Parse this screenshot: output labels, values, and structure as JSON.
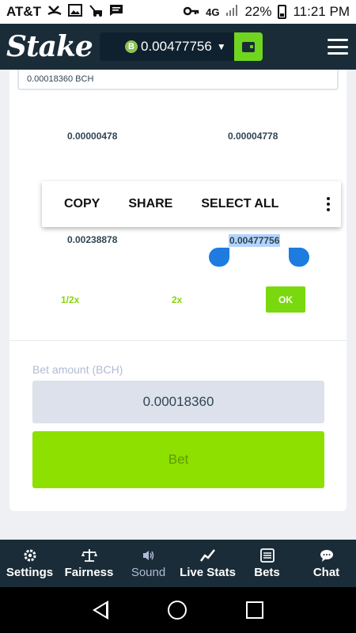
{
  "status_bar": {
    "carrier": "AT&T",
    "network": "4G",
    "battery": "22%",
    "time": "11:21 PM"
  },
  "header": {
    "logo": "Stake",
    "balance": "0.00477756",
    "currency_icon": "B"
  },
  "card": {
    "top_input_value": "0.00018360 BCH",
    "amounts": [
      "0.00000478",
      "0.00004778",
      "0.00238878",
      "0.00477756"
    ],
    "quick_buttons": {
      "half": "1/2x",
      "double": "2x",
      "ok": "OK"
    },
    "bet_amount_label": "Bet amount (BCH)",
    "bet_amount_value": "0.00018360",
    "bet_button": "Bet"
  },
  "context_menu": {
    "copy": "COPY",
    "share": "SHARE",
    "select_all": "SELECT ALL"
  },
  "bottom_tabs": [
    {
      "label": "Settings",
      "icon": "gear-icon"
    },
    {
      "label": "Fairness",
      "icon": "scale-icon"
    },
    {
      "label": "Sound",
      "icon": "speaker-icon"
    },
    {
      "label": "Live Stats",
      "icon": "chart-line-icon"
    },
    {
      "label": "Bets",
      "icon": "list-icon"
    },
    {
      "label": "Chat",
      "icon": "chat-icon"
    }
  ],
  "colors": {
    "header_bg": "#1a2c38",
    "accent_green": "#79d90e",
    "selection": "#1e7be0"
  }
}
